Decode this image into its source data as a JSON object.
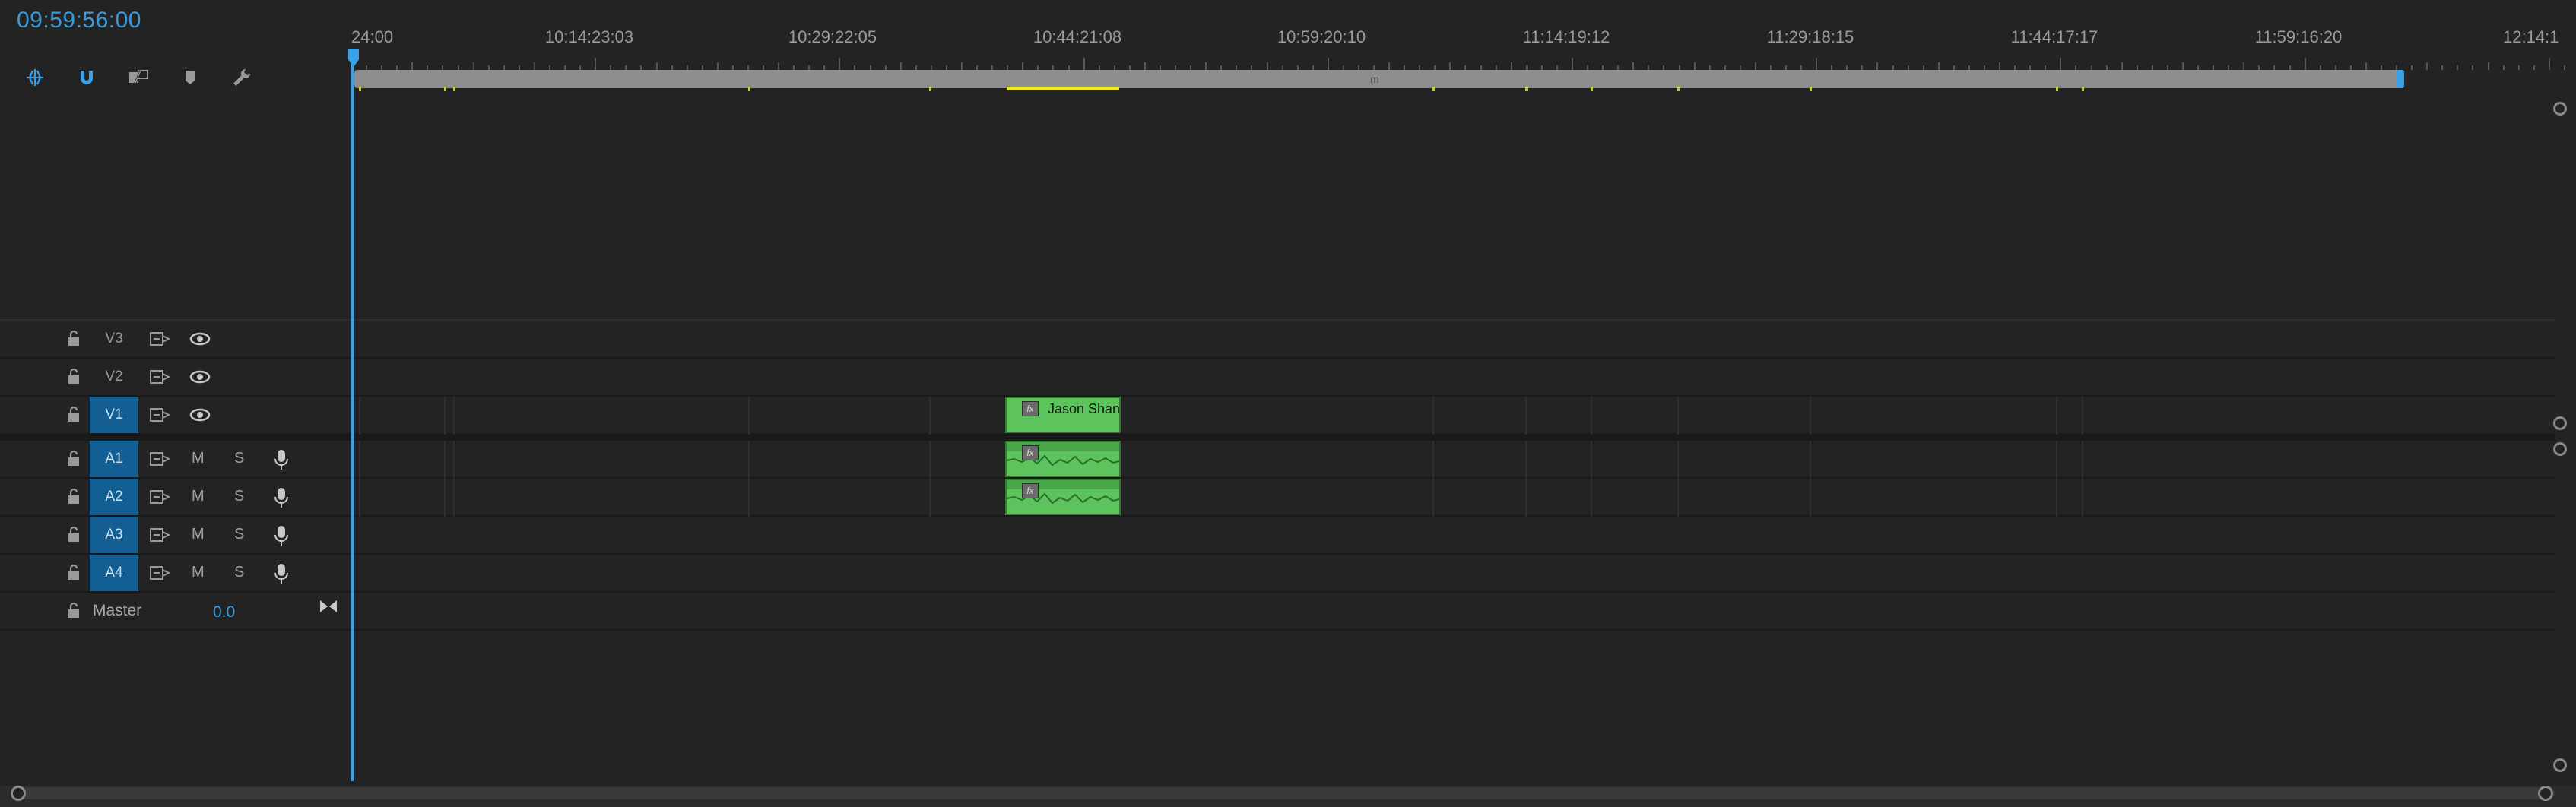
{
  "timecode": "09:59:56:00",
  "tools": [
    {
      "name": "ripple-edit-icon"
    },
    {
      "name": "snap-magnet-icon"
    },
    {
      "name": "linked-selection-icon"
    },
    {
      "name": "add-marker-icon"
    },
    {
      "name": "settings-wrench-icon"
    }
  ],
  "ruler": {
    "labels": [
      "24:00",
      "10:14:23:03",
      "10:29:22:05",
      "10:44:21:08",
      "10:59:20:10",
      "11:14:19:12",
      "11:29:18:15",
      "11:44:17:17",
      "11:59:16:20",
      "12:14:1"
    ]
  },
  "video_tracks": [
    {
      "name": "V3",
      "active": false
    },
    {
      "name": "V2",
      "active": false
    },
    {
      "name": "V1",
      "active": true
    }
  ],
  "audio_tracks": [
    {
      "name": "A1",
      "active": true,
      "mute": "M",
      "solo": "S"
    },
    {
      "name": "A2",
      "active": true,
      "mute": "M",
      "solo": "S"
    },
    {
      "name": "A3",
      "active": true,
      "mute": "M",
      "solo": "S"
    },
    {
      "name": "A4",
      "active": true,
      "mute": "M",
      "solo": "S"
    }
  ],
  "master": {
    "label": "Master",
    "value": "0.0"
  },
  "clips": {
    "video": {
      "name": "Jason Shan",
      "fx": "fx"
    },
    "audio1": {
      "fx": "fx"
    },
    "audio2": {
      "fx": "fx"
    }
  },
  "zoom_grip": "m",
  "colors": {
    "accent": "#3aa0e8",
    "clip": "#5dc35c",
    "track_active": "#135f94",
    "marker": "#e9e933"
  }
}
